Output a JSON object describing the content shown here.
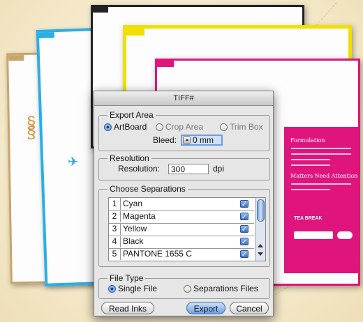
{
  "dialog": {
    "title": "TIFF#",
    "export_area": {
      "legend": "Export Area",
      "options": [
        "ArtBoard",
        "Crop Area",
        "Trim Box"
      ],
      "selected": "ArtBoard",
      "bleed_label": "Bleed:",
      "bleed_value": "0 mm"
    },
    "resolution": {
      "legend": "Resolution",
      "label": "Resolution:",
      "value": "300",
      "unit": "dpi"
    },
    "separations": {
      "legend": "Choose Separations",
      "rows": [
        {
          "num": "1",
          "name": "Cyan",
          "checked": true
        },
        {
          "num": "2",
          "name": "Magenta",
          "checked": true
        },
        {
          "num": "3",
          "name": "Yellow",
          "checked": true
        },
        {
          "num": "4",
          "name": "Black",
          "checked": true
        },
        {
          "num": "5",
          "name": "PANTONE 1655 C",
          "checked": true
        }
      ]
    },
    "file_type": {
      "legend": "File Type",
      "options": [
        "Single File",
        "Separations Files"
      ],
      "selected": "Single File"
    },
    "buttons": {
      "read_inks": "Read Inks",
      "export": "Export",
      "cancel": "Cancel"
    }
  },
  "background_artwork": {
    "magenta_card": {
      "heading_1": "Formulation",
      "heading_2": "Matters Need Attention",
      "badge": "TEA BREAK"
    }
  },
  "colors": {
    "magenta": "#e0147d",
    "cyan": "#29aee6",
    "yellow": "#f0e000",
    "gold": "#c9a46b",
    "dialog_bg": "#e6e6e6",
    "accent_blue": "#6f9fe4"
  }
}
